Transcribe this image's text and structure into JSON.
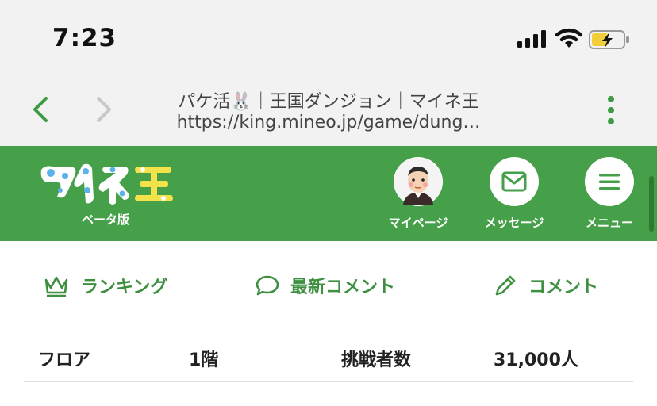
{
  "status_bar": {
    "time": "7:23"
  },
  "browser": {
    "title": "パケ活🐰｜王国ダンジョン｜マイネ王",
    "url": "https://king.mineo.jp/game/dung…"
  },
  "header": {
    "logo_text": "マイネ王",
    "logo_sub": "ベータ版",
    "mypage_label": "マイページ",
    "message_label": "メッセージ",
    "menu_label": "メニュー"
  },
  "tabs": {
    "ranking": "ランキング",
    "latest_comments": "最新コメント",
    "comment": "コメント"
  },
  "table": {
    "rows": [
      {
        "label1": "フロア",
        "value1": "1階",
        "label2": "挑戦者数",
        "value2": "31,000人"
      }
    ]
  },
  "colors": {
    "brand_green": "#46a049",
    "accent_green": "#3f8f40",
    "status_bg": "#f2f2f2"
  }
}
